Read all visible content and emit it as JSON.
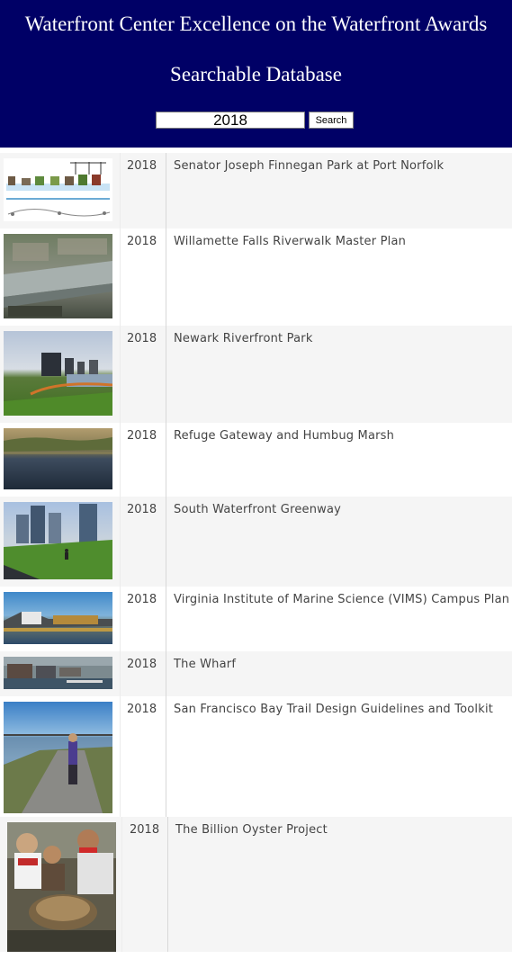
{
  "header": {
    "title": "Waterfront Center Excellence on the Waterfront Awards",
    "subtitle": "Searchable Database",
    "search_value": "2018",
    "search_button_label": "Search",
    "background": "#000066"
  },
  "results": [
    {
      "year": "2018",
      "name": "Senator Joseph Finnegan Park at Port Norfolk",
      "thumbnail": "park-section-diagram"
    },
    {
      "year": "2018",
      "name": "Willamette Falls Riverwalk Master Plan",
      "thumbnail": "aerial-river-town"
    },
    {
      "year": "2018",
      "name": "Newark Riverfront Park",
      "thumbnail": "riverfront-park-skyline"
    },
    {
      "year": "2018",
      "name": "Refuge Gateway and Humbug Marsh",
      "thumbnail": "marsh-water"
    },
    {
      "year": "2018",
      "name": "South Waterfront Greenway",
      "thumbnail": "greenway-towers"
    },
    {
      "year": "2018",
      "name": "Virginia Institute of Marine Science (VIMS) Campus Plan",
      "thumbnail": "campus-waterfront"
    },
    {
      "year": "2018",
      "name": "The Wharf",
      "thumbnail": "wharf-marina"
    },
    {
      "year": "2018",
      "name": "San Francisco Bay Trail Design Guidelines and Toolkit",
      "thumbnail": "bay-trail-walker"
    },
    {
      "year": "2018",
      "name": "The Billion Oyster Project",
      "thumbnail": "oyster-volunteers"
    }
  ]
}
